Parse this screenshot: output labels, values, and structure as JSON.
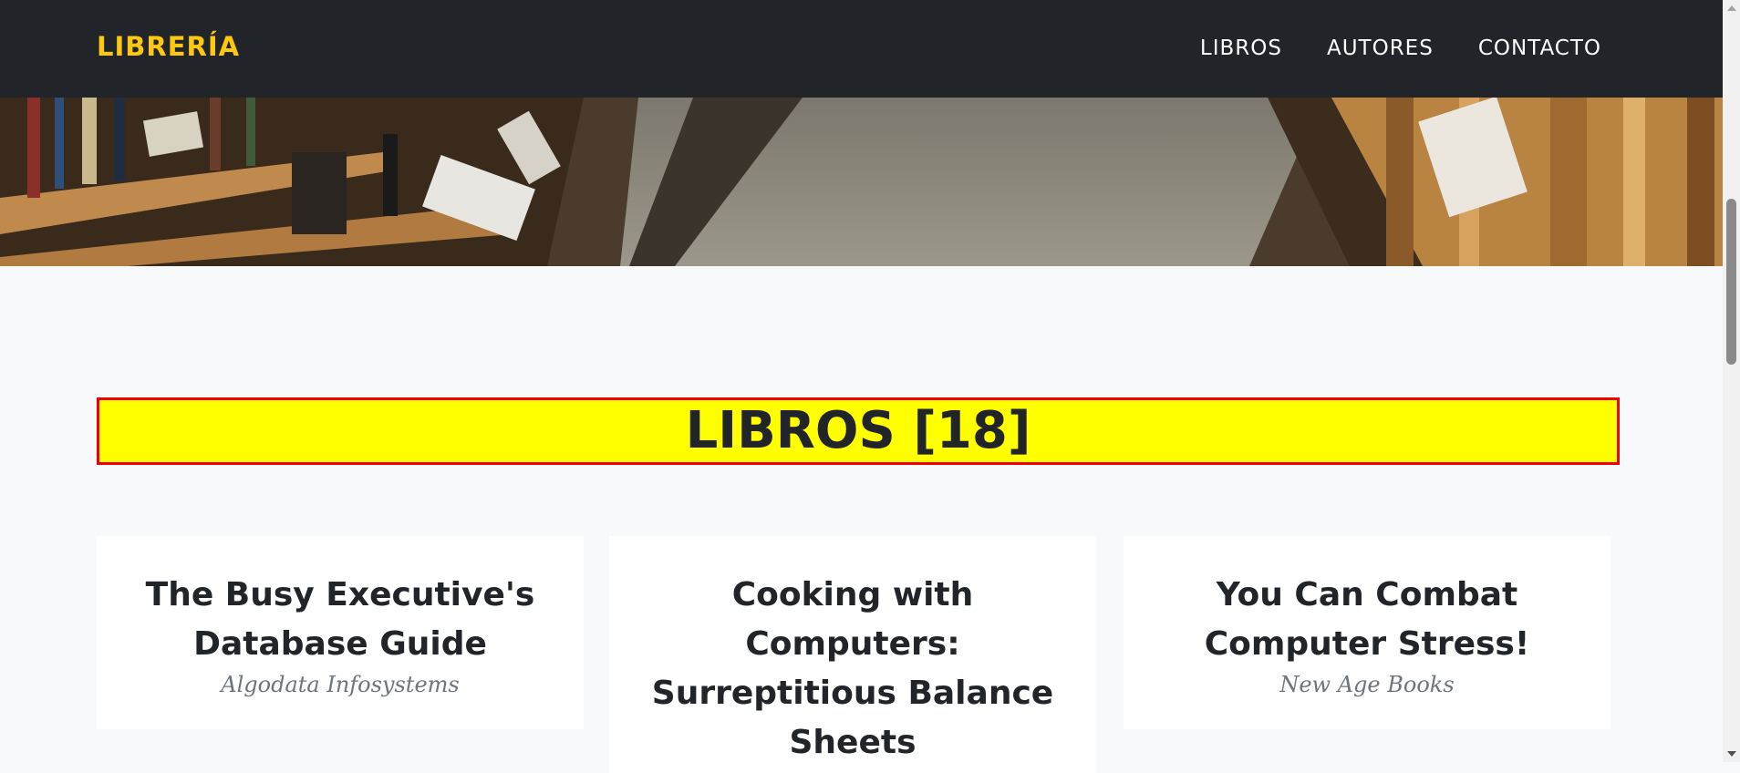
{
  "navbar": {
    "brand": "LIBRERÍA",
    "links": [
      "LIBROS",
      "AUTORES",
      "CONTACTO"
    ]
  },
  "section": {
    "title": "LIBROS [18]"
  },
  "books": [
    {
      "title": "The Busy Executive's Database Guide",
      "publisher": "Algodata Infosystems"
    },
    {
      "title": "Cooking with Computers: Surreptitious Balance Sheets",
      "publisher": ""
    },
    {
      "title": "You Can Combat Computer Stress!",
      "publisher": "New Age Books"
    }
  ],
  "colors": {
    "navbar_bg": "#212529",
    "brand": "#fec810",
    "title_bg": "#ffff00",
    "title_border": "#ee0000",
    "page_bg": "#f8f9fa"
  }
}
